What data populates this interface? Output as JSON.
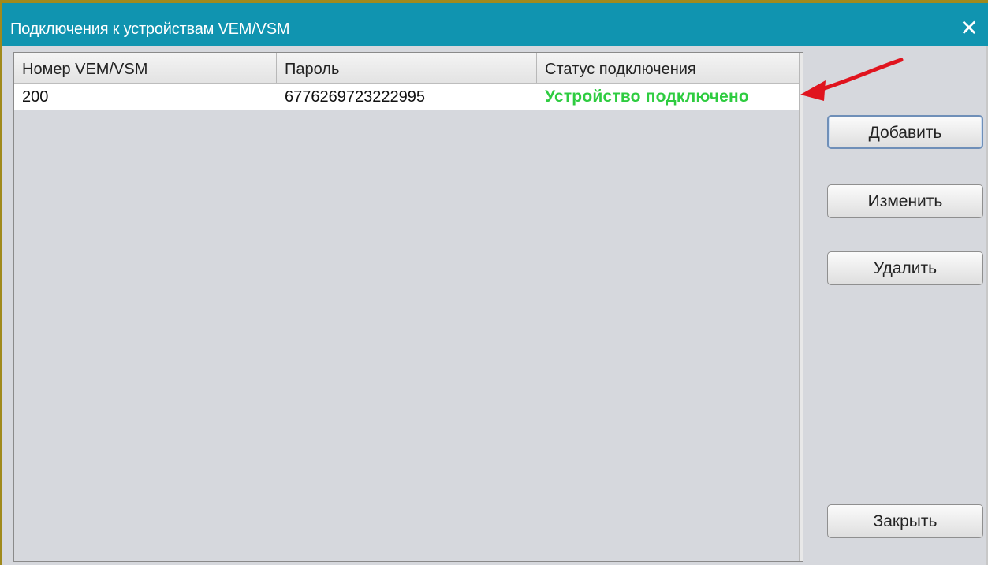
{
  "window": {
    "title": "Подключения к устройствам VEM/VSM",
    "close_symbol": "✕",
    "title_color": "#1094b0"
  },
  "table": {
    "columns": [
      "Номер VEM/VSM",
      "Пароль",
      "Статус подключения"
    ],
    "rows": [
      {
        "number": "200",
        "password": "6776269723222995",
        "status": "Устройство подключено",
        "status_color": "#2ecc40"
      }
    ]
  },
  "buttons": {
    "add": "Добавить",
    "edit": "Изменить",
    "delete": "Удалить",
    "close": "Закрыть"
  },
  "annotation": {
    "arrow_color": "#e0141e",
    "arrow_icon": "red-arrow-annotation"
  }
}
